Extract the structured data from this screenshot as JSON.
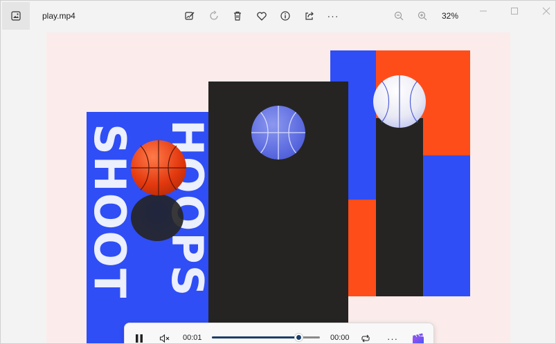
{
  "titlebar": {
    "app_icon": "photos-app-icon",
    "filename": "play.mp4",
    "toolbar_icons": [
      "edit-image-icon",
      "rotate-icon",
      "delete-icon",
      "favorite-heart-icon",
      "info-icon",
      "share-icon",
      "more-icon"
    ],
    "zoom_out_icon": "zoom-out-icon",
    "zoom_in_icon": "zoom-in-icon",
    "zoom_level": "32%",
    "more_glyph": "···"
  },
  "poster": {
    "text_top": "SHOOT",
    "text_bottom": "HOOPS",
    "colors": {
      "background": "#fbeceb",
      "blue": "#2f4ef6",
      "orange": "#ff4d1a",
      "dark": "#252422",
      "text": "#eceffc"
    }
  },
  "player": {
    "play_state_icon": "pause-icon",
    "volume_icon": "mute-icon",
    "current_time": "00:01",
    "total_time": "00:00",
    "progress": 0.8,
    "loop_icon": "loop-icon",
    "more_glyph": "···",
    "clipchamp_icon": "clipchamp-icon"
  }
}
